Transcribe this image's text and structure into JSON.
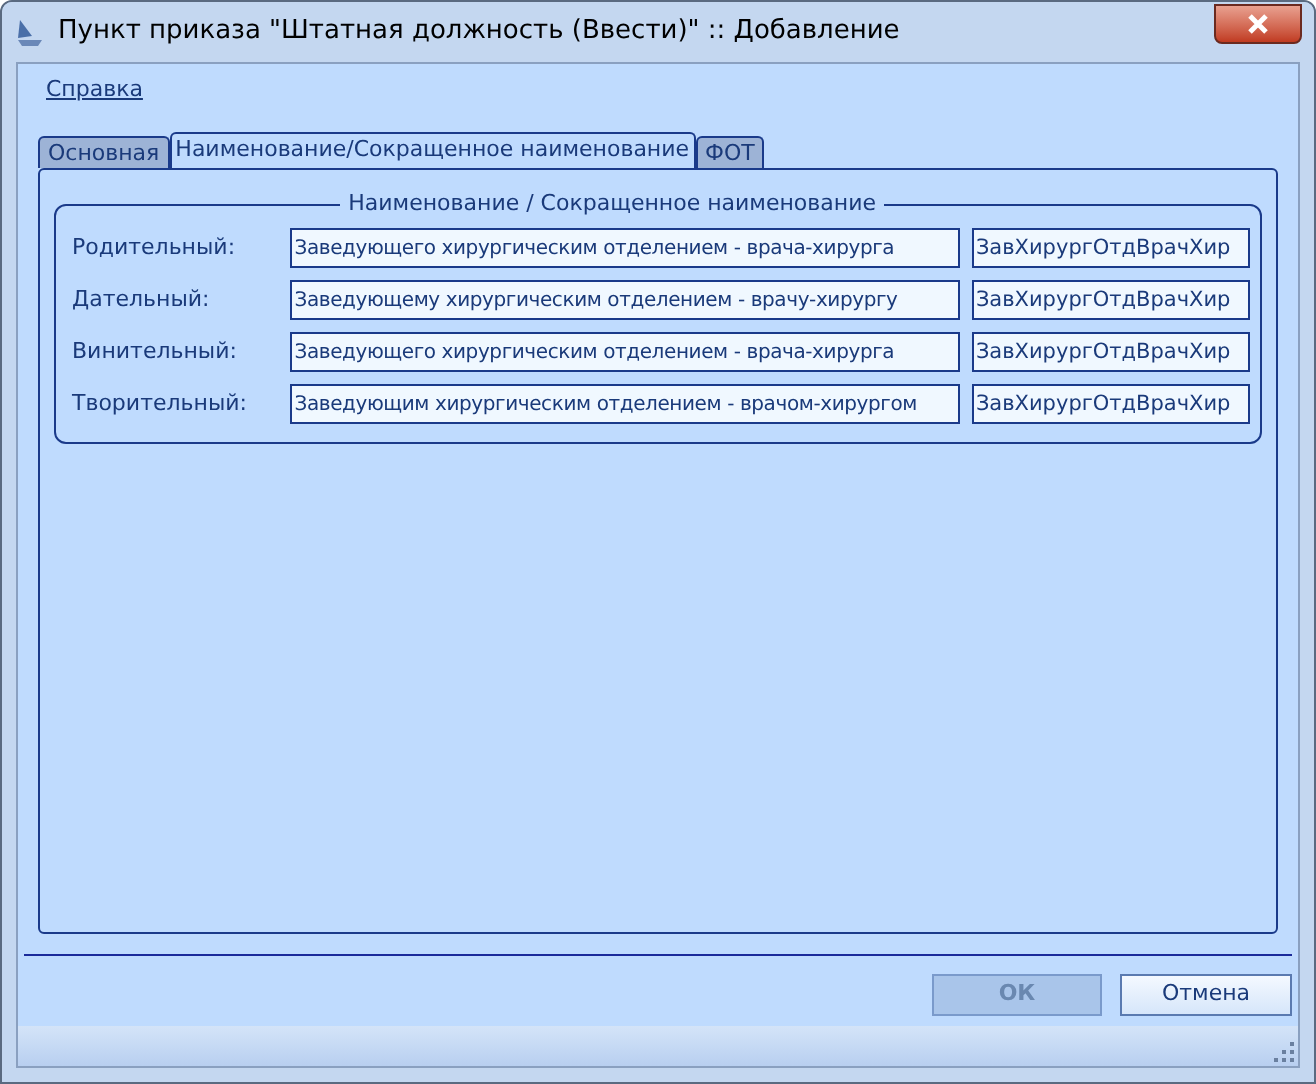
{
  "window": {
    "title": "Пункт приказа \"Штатная должность (Ввести)\" :: Добавление"
  },
  "menu": [
    "Справка"
  ],
  "tabs": [
    {
      "label": "Основная",
      "selected": false
    },
    {
      "label": "Наименование/Сокращенное наименование",
      "selected": true
    },
    {
      "label": "ФОТ",
      "selected": false
    }
  ],
  "group": {
    "title": "Наименование / Сокращенное наименование",
    "rows": [
      {
        "label": "Родительный:",
        "full": "Заведующего хирургическим отделением - врача-хирурга",
        "short": "ЗавХирургОтдВрачХир"
      },
      {
        "label": "Дательный:",
        "full": "Заведующему хирургическим отделением - врачу-хирургу",
        "short": "ЗавХирургОтдВрачХир"
      },
      {
        "label": "Винительный:",
        "full": "Заведующего хирургическим отделением - врача-хирурга",
        "short": "ЗавХирургОтдВрачХир"
      },
      {
        "label": "Творительный:",
        "full": "Заведующим хирургическим отделением - врачом-хирургом",
        "short": "ЗавХирургОтдВрачХир"
      }
    ]
  },
  "buttons": [
    {
      "label": "ОК",
      "disabled": true
    },
    {
      "label": "Отмена",
      "disabled": false
    }
  ]
}
